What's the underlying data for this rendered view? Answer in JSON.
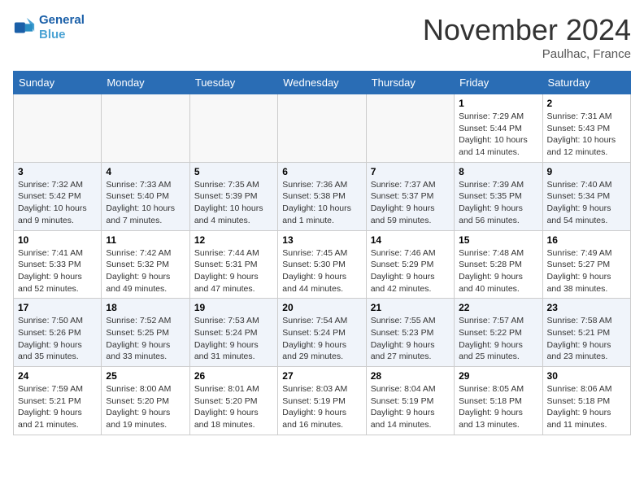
{
  "logo": {
    "line1": "General",
    "line2": "Blue"
  },
  "title": "November 2024",
  "location": "Paulhac, France",
  "days_of_week": [
    "Sunday",
    "Monday",
    "Tuesday",
    "Wednesday",
    "Thursday",
    "Friday",
    "Saturday"
  ],
  "weeks": [
    [
      {
        "day": "",
        "info": ""
      },
      {
        "day": "",
        "info": ""
      },
      {
        "day": "",
        "info": ""
      },
      {
        "day": "",
        "info": ""
      },
      {
        "day": "",
        "info": ""
      },
      {
        "day": "1",
        "info": "Sunrise: 7:29 AM\nSunset: 5:44 PM\nDaylight: 10 hours and 14 minutes."
      },
      {
        "day": "2",
        "info": "Sunrise: 7:31 AM\nSunset: 5:43 PM\nDaylight: 10 hours and 12 minutes."
      }
    ],
    [
      {
        "day": "3",
        "info": "Sunrise: 7:32 AM\nSunset: 5:42 PM\nDaylight: 10 hours and 9 minutes."
      },
      {
        "day": "4",
        "info": "Sunrise: 7:33 AM\nSunset: 5:40 PM\nDaylight: 10 hours and 7 minutes."
      },
      {
        "day": "5",
        "info": "Sunrise: 7:35 AM\nSunset: 5:39 PM\nDaylight: 10 hours and 4 minutes."
      },
      {
        "day": "6",
        "info": "Sunrise: 7:36 AM\nSunset: 5:38 PM\nDaylight: 10 hours and 1 minute."
      },
      {
        "day": "7",
        "info": "Sunrise: 7:37 AM\nSunset: 5:37 PM\nDaylight: 9 hours and 59 minutes."
      },
      {
        "day": "8",
        "info": "Sunrise: 7:39 AM\nSunset: 5:35 PM\nDaylight: 9 hours and 56 minutes."
      },
      {
        "day": "9",
        "info": "Sunrise: 7:40 AM\nSunset: 5:34 PM\nDaylight: 9 hours and 54 minutes."
      }
    ],
    [
      {
        "day": "10",
        "info": "Sunrise: 7:41 AM\nSunset: 5:33 PM\nDaylight: 9 hours and 52 minutes."
      },
      {
        "day": "11",
        "info": "Sunrise: 7:42 AM\nSunset: 5:32 PM\nDaylight: 9 hours and 49 minutes."
      },
      {
        "day": "12",
        "info": "Sunrise: 7:44 AM\nSunset: 5:31 PM\nDaylight: 9 hours and 47 minutes."
      },
      {
        "day": "13",
        "info": "Sunrise: 7:45 AM\nSunset: 5:30 PM\nDaylight: 9 hours and 44 minutes."
      },
      {
        "day": "14",
        "info": "Sunrise: 7:46 AM\nSunset: 5:29 PM\nDaylight: 9 hours and 42 minutes."
      },
      {
        "day": "15",
        "info": "Sunrise: 7:48 AM\nSunset: 5:28 PM\nDaylight: 9 hours and 40 minutes."
      },
      {
        "day": "16",
        "info": "Sunrise: 7:49 AM\nSunset: 5:27 PM\nDaylight: 9 hours and 38 minutes."
      }
    ],
    [
      {
        "day": "17",
        "info": "Sunrise: 7:50 AM\nSunset: 5:26 PM\nDaylight: 9 hours and 35 minutes."
      },
      {
        "day": "18",
        "info": "Sunrise: 7:52 AM\nSunset: 5:25 PM\nDaylight: 9 hours and 33 minutes."
      },
      {
        "day": "19",
        "info": "Sunrise: 7:53 AM\nSunset: 5:24 PM\nDaylight: 9 hours and 31 minutes."
      },
      {
        "day": "20",
        "info": "Sunrise: 7:54 AM\nSunset: 5:24 PM\nDaylight: 9 hours and 29 minutes."
      },
      {
        "day": "21",
        "info": "Sunrise: 7:55 AM\nSunset: 5:23 PM\nDaylight: 9 hours and 27 minutes."
      },
      {
        "day": "22",
        "info": "Sunrise: 7:57 AM\nSunset: 5:22 PM\nDaylight: 9 hours and 25 minutes."
      },
      {
        "day": "23",
        "info": "Sunrise: 7:58 AM\nSunset: 5:21 PM\nDaylight: 9 hours and 23 minutes."
      }
    ],
    [
      {
        "day": "24",
        "info": "Sunrise: 7:59 AM\nSunset: 5:21 PM\nDaylight: 9 hours and 21 minutes."
      },
      {
        "day": "25",
        "info": "Sunrise: 8:00 AM\nSunset: 5:20 PM\nDaylight: 9 hours and 19 minutes."
      },
      {
        "day": "26",
        "info": "Sunrise: 8:01 AM\nSunset: 5:20 PM\nDaylight: 9 hours and 18 minutes."
      },
      {
        "day": "27",
        "info": "Sunrise: 8:03 AM\nSunset: 5:19 PM\nDaylight: 9 hours and 16 minutes."
      },
      {
        "day": "28",
        "info": "Sunrise: 8:04 AM\nSunset: 5:19 PM\nDaylight: 9 hours and 14 minutes."
      },
      {
        "day": "29",
        "info": "Sunrise: 8:05 AM\nSunset: 5:18 PM\nDaylight: 9 hours and 13 minutes."
      },
      {
        "day": "30",
        "info": "Sunrise: 8:06 AM\nSunset: 5:18 PM\nDaylight: 9 hours and 11 minutes."
      }
    ]
  ]
}
